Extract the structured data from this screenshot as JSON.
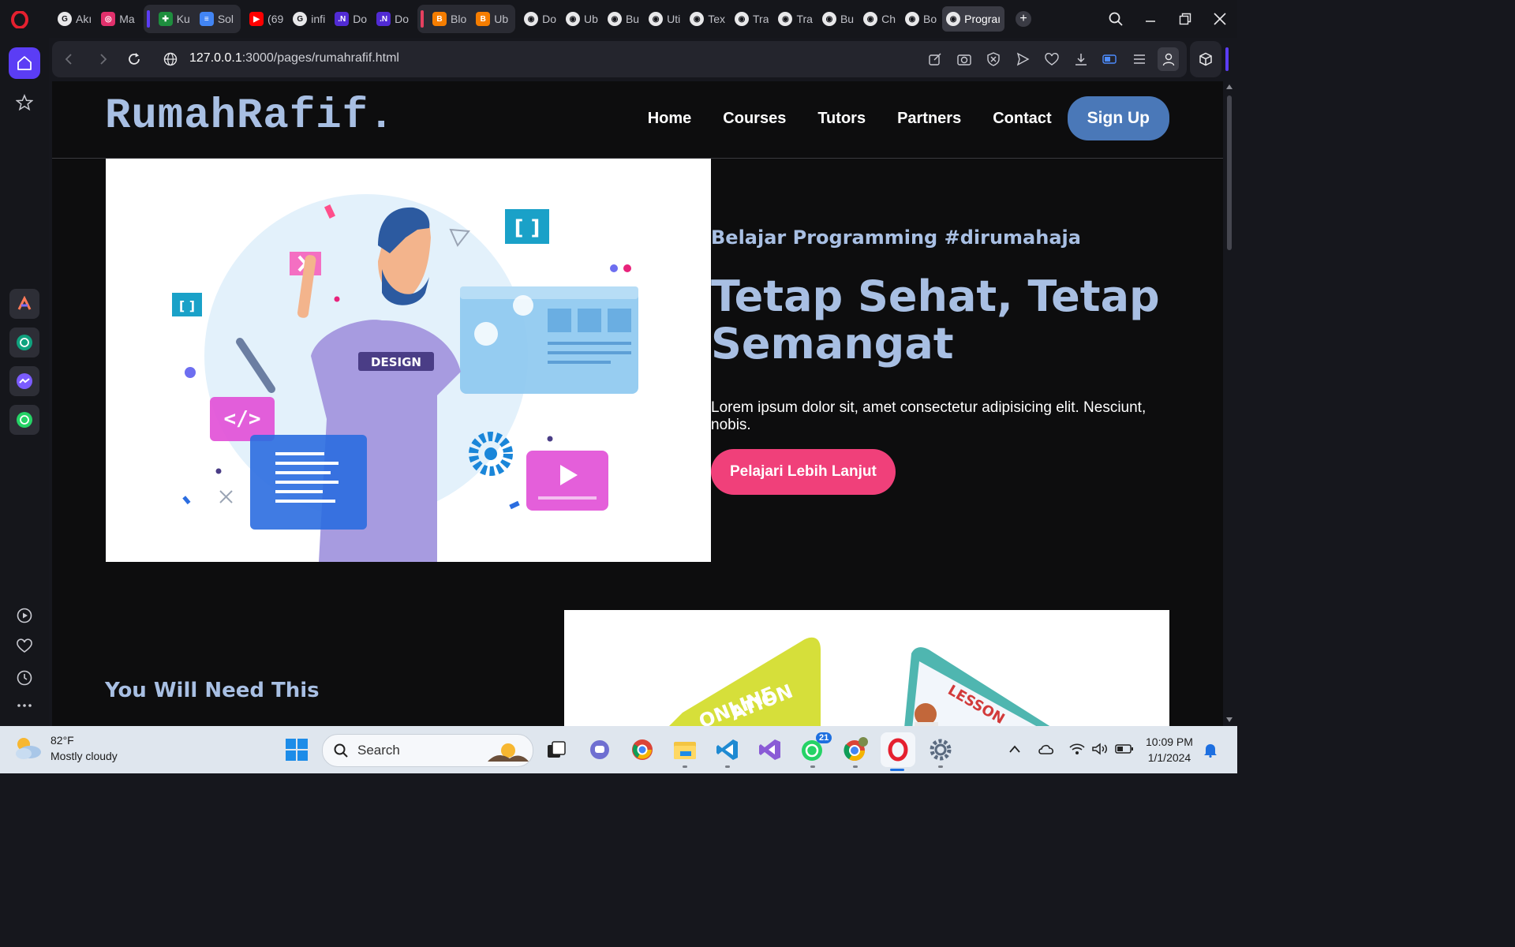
{
  "browser": {
    "tabs": [
      {
        "title": "Akı",
        "favicon": "google-icon",
        "color": "#ffffff"
      },
      {
        "title": "Ma",
        "favicon": "instagram-icon",
        "color": "#e1306c"
      },
      {
        "title": "Ku",
        "favicon": "sheets-icon",
        "color": "#1e8e3e"
      },
      {
        "title": "Sol",
        "favicon": "docs-icon",
        "color": "#4285f4"
      },
      {
        "title": "(69",
        "favicon": "youtube-icon",
        "color": "#ff0000"
      },
      {
        "title": "infi",
        "favicon": "google-icon",
        "color": "#ffffff"
      },
      {
        "title": "Do",
        "favicon": "dotnet-icon",
        "color": "#512bd4"
      },
      {
        "title": "Do",
        "favicon": "dotnet-icon",
        "color": "#512bd4"
      },
      {
        "title": "Blo",
        "favicon": "blogger-icon",
        "color": "#f57d00"
      },
      {
        "title": "Ub",
        "favicon": "blogger-icon",
        "color": "#f57d00"
      },
      {
        "title": "Do",
        "favicon": "globe-icon",
        "color": "#ffffff"
      },
      {
        "title": "Ub",
        "favicon": "globe-icon",
        "color": "#ffffff"
      },
      {
        "title": "Bu",
        "favicon": "globe-icon",
        "color": "#ffffff"
      },
      {
        "title": "Uti",
        "favicon": "globe-icon",
        "color": "#ffffff"
      },
      {
        "title": "Tex",
        "favicon": "globe-icon",
        "color": "#ffffff"
      },
      {
        "title": "Tra",
        "favicon": "globe-icon",
        "color": "#ffffff"
      },
      {
        "title": "Tra",
        "favicon": "globe-icon",
        "color": "#ffffff"
      },
      {
        "title": "Bu",
        "favicon": "globe-icon",
        "color": "#ffffff"
      },
      {
        "title": "Ch",
        "favicon": "globe-icon",
        "color": "#ffffff"
      },
      {
        "title": "Bo",
        "favicon": "globe-icon",
        "color": "#ffffff"
      },
      {
        "title": "Prograı",
        "favicon": "globe-icon",
        "color": "#ffffff",
        "active": true
      }
    ],
    "address": {
      "host": "127.0.0.1",
      "path": ":3000/pages/rumahrafif.html"
    },
    "accent": "#5b3df5"
  },
  "site": {
    "brand": "RumahRafif.",
    "nav": [
      "Home",
      "Courses",
      "Tutors",
      "Partners",
      "Contact"
    ],
    "signup": "Sign Up",
    "hero": {
      "tagline": "Belajar Programming #dirumahaja",
      "headline": "Tetap Sehat, Tetap Semangat",
      "description": "Lorem ipsum dolor sit, amet consectetur adipisicing elit. Nesciunt, nobis.",
      "cta": "Pelajari Lebih Lanjut",
      "image_badge": "DESIGN"
    },
    "section_title": "You Will Need This",
    "second_image_words": [
      "ONLINE",
      "ATION",
      "LESSON"
    ],
    "colors": {
      "accent_blue": "#a8bfe3",
      "signup": "#4a78b8",
      "cta": "#f0407a"
    }
  },
  "taskbar": {
    "weather": {
      "temp": "82°F",
      "condition": "Mostly cloudy"
    },
    "search_placeholder": "Search",
    "whatsapp_badge": "21",
    "time": "10:09 PM",
    "date": "1/1/2024"
  }
}
